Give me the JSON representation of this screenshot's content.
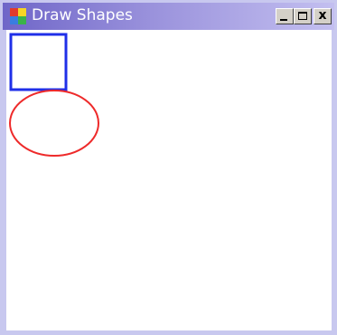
{
  "window": {
    "title": "Draw Shapes",
    "app_icon": "windows-form-icon",
    "controls": {
      "minimize_icon": "minimize-icon",
      "maximize_icon": "maximize-icon",
      "close_icon": "close-icon",
      "close_glyph": "x"
    }
  },
  "canvas": {
    "shapes": [
      {
        "type": "rectangle",
        "stroke": "#1f2fe8",
        "fill": "none"
      },
      {
        "type": "ellipse",
        "stroke": "#ee2a2a",
        "fill": "none"
      }
    ]
  },
  "colors": {
    "titlebar_start": "#6f66c8",
    "titlebar_end": "#c3bff0",
    "window_frame": "#c8c8ef",
    "canvas_background": "#ffffff"
  }
}
